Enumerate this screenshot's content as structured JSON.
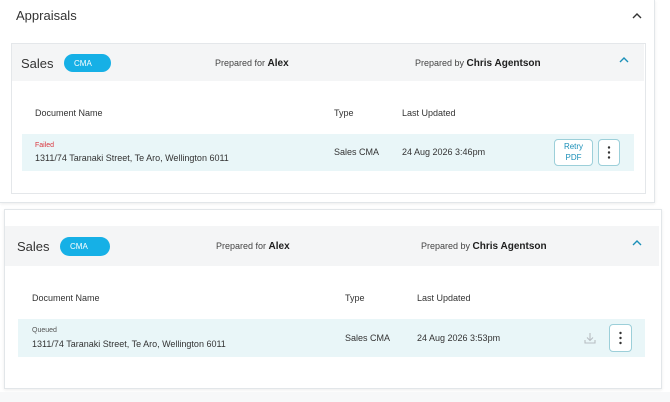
{
  "section": {
    "title": "Appraisals"
  },
  "cards": [
    {
      "title": "Sales",
      "badge": "CMA",
      "prepared_for_label": "Prepared for",
      "prepared_for_name": "Alex",
      "prepared_by_label": "Prepared by",
      "prepared_by_name": "Chris Agentson",
      "columns": [
        "Document Name",
        "Type",
        "Last Updated"
      ],
      "row": {
        "status": "Failed",
        "address": "1311/74 Taranaki Street, Te Aro, Wellington 6011",
        "type": "Sales CMA",
        "updated": "24 Aug 2026 3:46pm",
        "retry_line1": "Retry",
        "retry_line2": "PDF"
      }
    },
    {
      "title": "Sales",
      "badge": "CMA",
      "prepared_for_label": "Prepared for",
      "prepared_for_name": "Alex",
      "prepared_by_label": "Prepared by",
      "prepared_by_name": "Chris Agentson",
      "columns": [
        "Document Name",
        "Type",
        "Last Updated"
      ],
      "row": {
        "status": "Queued",
        "address": "1311/74 Taranaki Street, Te Aro, Wellington 6011",
        "type": "Sales CMA",
        "updated": "24 Aug 2026 3:53pm"
      }
    }
  ],
  "icons": [
    "chevron-up-icon",
    "more-vertical-icon",
    "download-icon"
  ],
  "colors": {
    "accent": "#16b0e6",
    "failed": "#d9363e",
    "row_bg": "#e9f6f8",
    "header_bg": "#f4f5f6"
  }
}
